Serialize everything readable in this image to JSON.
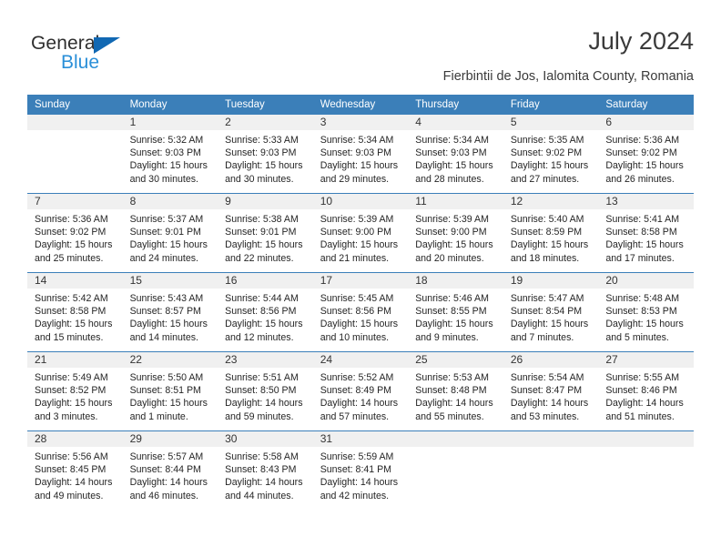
{
  "brand": {
    "name_part1": "General",
    "name_part2": "Blue",
    "triangle_color": "#1168b3",
    "blue_color": "#2a8fd8"
  },
  "header": {
    "title": "July 2024",
    "subtitle": "Fierbintii de Jos, Ialomita County, Romania"
  },
  "theme": {
    "header_blue": "#3b7fb9",
    "daynum_band": "#f0f0f0",
    "text": "#252525"
  },
  "calendar": {
    "weekday_headers": [
      "Sunday",
      "Monday",
      "Tuesday",
      "Wednesday",
      "Thursday",
      "Friday",
      "Saturday"
    ],
    "weeks": [
      [
        {
          "day": "",
          "blank": true,
          "sunrise": "",
          "sunset": "",
          "daylight": ""
        },
        {
          "day": "1",
          "sunrise": "Sunrise: 5:32 AM",
          "sunset": "Sunset: 9:03 PM",
          "daylight": "Daylight: 15 hours and 30 minutes."
        },
        {
          "day": "2",
          "sunrise": "Sunrise: 5:33 AM",
          "sunset": "Sunset: 9:03 PM",
          "daylight": "Daylight: 15 hours and 30 minutes."
        },
        {
          "day": "3",
          "sunrise": "Sunrise: 5:34 AM",
          "sunset": "Sunset: 9:03 PM",
          "daylight": "Daylight: 15 hours and 29 minutes."
        },
        {
          "day": "4",
          "sunrise": "Sunrise: 5:34 AM",
          "sunset": "Sunset: 9:03 PM",
          "daylight": "Daylight: 15 hours and 28 minutes."
        },
        {
          "day": "5",
          "sunrise": "Sunrise: 5:35 AM",
          "sunset": "Sunset: 9:02 PM",
          "daylight": "Daylight: 15 hours and 27 minutes."
        },
        {
          "day": "6",
          "sunrise": "Sunrise: 5:36 AM",
          "sunset": "Sunset: 9:02 PM",
          "daylight": "Daylight: 15 hours and 26 minutes."
        }
      ],
      [
        {
          "day": "7",
          "sunrise": "Sunrise: 5:36 AM",
          "sunset": "Sunset: 9:02 PM",
          "daylight": "Daylight: 15 hours and 25 minutes."
        },
        {
          "day": "8",
          "sunrise": "Sunrise: 5:37 AM",
          "sunset": "Sunset: 9:01 PM",
          "daylight": "Daylight: 15 hours and 24 minutes."
        },
        {
          "day": "9",
          "sunrise": "Sunrise: 5:38 AM",
          "sunset": "Sunset: 9:01 PM",
          "daylight": "Daylight: 15 hours and 22 minutes."
        },
        {
          "day": "10",
          "sunrise": "Sunrise: 5:39 AM",
          "sunset": "Sunset: 9:00 PM",
          "daylight": "Daylight: 15 hours and 21 minutes."
        },
        {
          "day": "11",
          "sunrise": "Sunrise: 5:39 AM",
          "sunset": "Sunset: 9:00 PM",
          "daylight": "Daylight: 15 hours and 20 minutes."
        },
        {
          "day": "12",
          "sunrise": "Sunrise: 5:40 AM",
          "sunset": "Sunset: 8:59 PM",
          "daylight": "Daylight: 15 hours and 18 minutes."
        },
        {
          "day": "13",
          "sunrise": "Sunrise: 5:41 AM",
          "sunset": "Sunset: 8:58 PM",
          "daylight": "Daylight: 15 hours and 17 minutes."
        }
      ],
      [
        {
          "day": "14",
          "sunrise": "Sunrise: 5:42 AM",
          "sunset": "Sunset: 8:58 PM",
          "daylight": "Daylight: 15 hours and 15 minutes."
        },
        {
          "day": "15",
          "sunrise": "Sunrise: 5:43 AM",
          "sunset": "Sunset: 8:57 PM",
          "daylight": "Daylight: 15 hours and 14 minutes."
        },
        {
          "day": "16",
          "sunrise": "Sunrise: 5:44 AM",
          "sunset": "Sunset: 8:56 PM",
          "daylight": "Daylight: 15 hours and 12 minutes."
        },
        {
          "day": "17",
          "sunrise": "Sunrise: 5:45 AM",
          "sunset": "Sunset: 8:56 PM",
          "daylight": "Daylight: 15 hours and 10 minutes."
        },
        {
          "day": "18",
          "sunrise": "Sunrise: 5:46 AM",
          "sunset": "Sunset: 8:55 PM",
          "daylight": "Daylight: 15 hours and 9 minutes."
        },
        {
          "day": "19",
          "sunrise": "Sunrise: 5:47 AM",
          "sunset": "Sunset: 8:54 PM",
          "daylight": "Daylight: 15 hours and 7 minutes."
        },
        {
          "day": "20",
          "sunrise": "Sunrise: 5:48 AM",
          "sunset": "Sunset: 8:53 PM",
          "daylight": "Daylight: 15 hours and 5 minutes."
        }
      ],
      [
        {
          "day": "21",
          "sunrise": "Sunrise: 5:49 AM",
          "sunset": "Sunset: 8:52 PM",
          "daylight": "Daylight: 15 hours and 3 minutes."
        },
        {
          "day": "22",
          "sunrise": "Sunrise: 5:50 AM",
          "sunset": "Sunset: 8:51 PM",
          "daylight": "Daylight: 15 hours and 1 minute."
        },
        {
          "day": "23",
          "sunrise": "Sunrise: 5:51 AM",
          "sunset": "Sunset: 8:50 PM",
          "daylight": "Daylight: 14 hours and 59 minutes."
        },
        {
          "day": "24",
          "sunrise": "Sunrise: 5:52 AM",
          "sunset": "Sunset: 8:49 PM",
          "daylight": "Daylight: 14 hours and 57 minutes."
        },
        {
          "day": "25",
          "sunrise": "Sunrise: 5:53 AM",
          "sunset": "Sunset: 8:48 PM",
          "daylight": "Daylight: 14 hours and 55 minutes."
        },
        {
          "day": "26",
          "sunrise": "Sunrise: 5:54 AM",
          "sunset": "Sunset: 8:47 PM",
          "daylight": "Daylight: 14 hours and 53 minutes."
        },
        {
          "day": "27",
          "sunrise": "Sunrise: 5:55 AM",
          "sunset": "Sunset: 8:46 PM",
          "daylight": "Daylight: 14 hours and 51 minutes."
        }
      ],
      [
        {
          "day": "28",
          "sunrise": "Sunrise: 5:56 AM",
          "sunset": "Sunset: 8:45 PM",
          "daylight": "Daylight: 14 hours and 49 minutes."
        },
        {
          "day": "29",
          "sunrise": "Sunrise: 5:57 AM",
          "sunset": "Sunset: 8:44 PM",
          "daylight": "Daylight: 14 hours and 46 minutes."
        },
        {
          "day": "30",
          "sunrise": "Sunrise: 5:58 AM",
          "sunset": "Sunset: 8:43 PM",
          "daylight": "Daylight: 14 hours and 44 minutes."
        },
        {
          "day": "31",
          "sunrise": "Sunrise: 5:59 AM",
          "sunset": "Sunset: 8:41 PM",
          "daylight": "Daylight: 14 hours and 42 minutes."
        },
        {
          "day": "",
          "blank": true,
          "sunrise": "",
          "sunset": "",
          "daylight": ""
        },
        {
          "day": "",
          "blank": true,
          "sunrise": "",
          "sunset": "",
          "daylight": ""
        },
        {
          "day": "",
          "blank": true,
          "sunrise": "",
          "sunset": "",
          "daylight": ""
        }
      ]
    ]
  }
}
